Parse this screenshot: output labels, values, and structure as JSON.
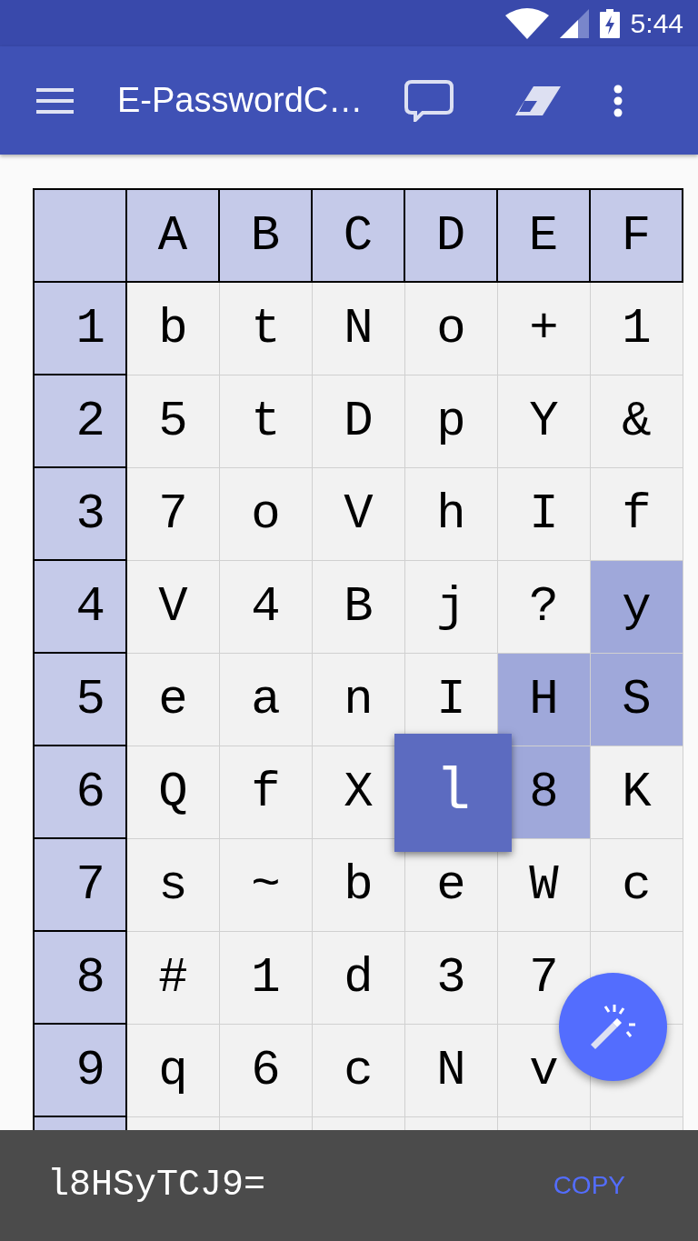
{
  "status_bar": {
    "time": "5:44"
  },
  "app_bar": {
    "title": "E-PasswordC…"
  },
  "grid": {
    "columns": [
      "A",
      "B",
      "C",
      "D",
      "E",
      "F"
    ],
    "rows": [
      {
        "label": "1",
        "cells": [
          {
            "char": "b",
            "highlighted": false,
            "selected": false
          },
          {
            "char": "t",
            "highlighted": false,
            "selected": false
          },
          {
            "char": "N",
            "highlighted": false,
            "selected": false
          },
          {
            "char": "o",
            "highlighted": false,
            "selected": false
          },
          {
            "char": "+",
            "highlighted": false,
            "selected": false
          },
          {
            "char": "1",
            "highlighted": false,
            "selected": false
          }
        ]
      },
      {
        "label": "2",
        "cells": [
          {
            "char": "5",
            "highlighted": false,
            "selected": false
          },
          {
            "char": "t",
            "highlighted": false,
            "selected": false
          },
          {
            "char": "D",
            "highlighted": false,
            "selected": false
          },
          {
            "char": "p",
            "highlighted": false,
            "selected": false
          },
          {
            "char": "Y",
            "highlighted": false,
            "selected": false
          },
          {
            "char": "&",
            "highlighted": false,
            "selected": false
          }
        ]
      },
      {
        "label": "3",
        "cells": [
          {
            "char": "7",
            "highlighted": false,
            "selected": false
          },
          {
            "char": "o",
            "highlighted": false,
            "selected": false
          },
          {
            "char": "V",
            "highlighted": false,
            "selected": false
          },
          {
            "char": "h",
            "highlighted": false,
            "selected": false
          },
          {
            "char": "I",
            "highlighted": false,
            "selected": false
          },
          {
            "char": "f",
            "highlighted": false,
            "selected": false
          }
        ]
      },
      {
        "label": "4",
        "cells": [
          {
            "char": "V",
            "highlighted": false,
            "selected": false
          },
          {
            "char": "4",
            "highlighted": false,
            "selected": false
          },
          {
            "char": "B",
            "highlighted": false,
            "selected": false
          },
          {
            "char": "j",
            "highlighted": false,
            "selected": false
          },
          {
            "char": "?",
            "highlighted": false,
            "selected": false
          },
          {
            "char": "y",
            "highlighted": true,
            "selected": false
          }
        ]
      },
      {
        "label": "5",
        "cells": [
          {
            "char": "e",
            "highlighted": false,
            "selected": false
          },
          {
            "char": "a",
            "highlighted": false,
            "selected": false
          },
          {
            "char": "n",
            "highlighted": false,
            "selected": false
          },
          {
            "char": "I",
            "highlighted": false,
            "selected": false
          },
          {
            "char": "H",
            "highlighted": true,
            "selected": false
          },
          {
            "char": "S",
            "highlighted": true,
            "selected": false
          }
        ]
      },
      {
        "label": "6",
        "cells": [
          {
            "char": "Q",
            "highlighted": false,
            "selected": false
          },
          {
            "char": "f",
            "highlighted": false,
            "selected": false
          },
          {
            "char": "X",
            "highlighted": false,
            "selected": false
          },
          {
            "char": "l",
            "highlighted": false,
            "selected": true
          },
          {
            "char": "8",
            "highlighted": true,
            "selected": false
          },
          {
            "char": "K",
            "highlighted": false,
            "selected": false
          }
        ]
      },
      {
        "label": "7",
        "cells": [
          {
            "char": "s",
            "highlighted": false,
            "selected": false
          },
          {
            "char": "~",
            "highlighted": false,
            "selected": false
          },
          {
            "char": "b",
            "highlighted": false,
            "selected": false
          },
          {
            "char": "e",
            "highlighted": false,
            "selected": false
          },
          {
            "char": "W",
            "highlighted": false,
            "selected": false
          },
          {
            "char": "c",
            "highlighted": false,
            "selected": false
          }
        ]
      },
      {
        "label": "8",
        "cells": [
          {
            "char": "#",
            "highlighted": false,
            "selected": false
          },
          {
            "char": "1",
            "highlighted": false,
            "selected": false
          },
          {
            "char": "d",
            "highlighted": false,
            "selected": false
          },
          {
            "char": "3",
            "highlighted": false,
            "selected": false
          },
          {
            "char": "7",
            "highlighted": false,
            "selected": false
          },
          {
            "highlighted": false,
            "selected": false
          }
        ]
      },
      {
        "label": "9",
        "cells": [
          {
            "char": "q",
            "highlighted": false,
            "selected": false
          },
          {
            "char": "6",
            "highlighted": false,
            "selected": false
          },
          {
            "char": "c",
            "highlighted": false,
            "selected": false
          },
          {
            "char": "N",
            "highlighted": false,
            "selected": false
          },
          {
            "char": "v",
            "highlighted": false,
            "selected": false
          },
          {
            "highlighted": false,
            "selected": false
          }
        ]
      }
    ]
  },
  "snackbar": {
    "password": "l8HSyTCJ9=",
    "action": "COPY"
  }
}
